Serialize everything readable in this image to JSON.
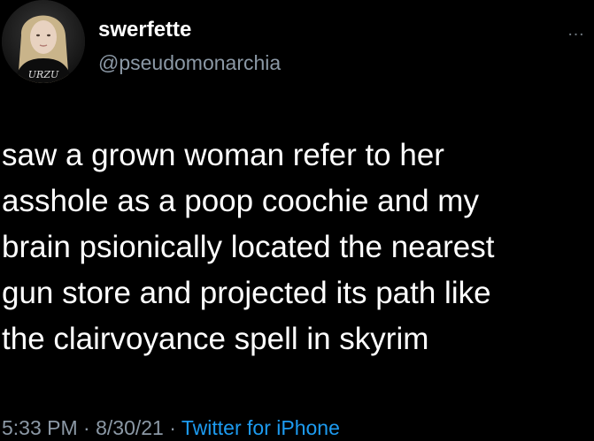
{
  "user": {
    "display_name": "swerfette",
    "handle": "@pseudomonarchia",
    "avatar_icon": "profile-photo"
  },
  "more_icon": "…",
  "tweet": {
    "lines": [
      "saw a grown woman refer to her",
      "asshole as a poop coochie and my",
      "brain psionically located the nearest",
      "gun store and projected its path like",
      "the clairvoyance spell in skyrim"
    ]
  },
  "meta": {
    "time": "5:33 PM",
    "sep1": " · ",
    "date": "8/30/21",
    "sep2": " · ",
    "source": "Twitter for iPhone"
  },
  "colors": {
    "background": "#000000",
    "text": "#ffffff",
    "secondary": "#8b98a5",
    "link": "#1d9bf0"
  }
}
